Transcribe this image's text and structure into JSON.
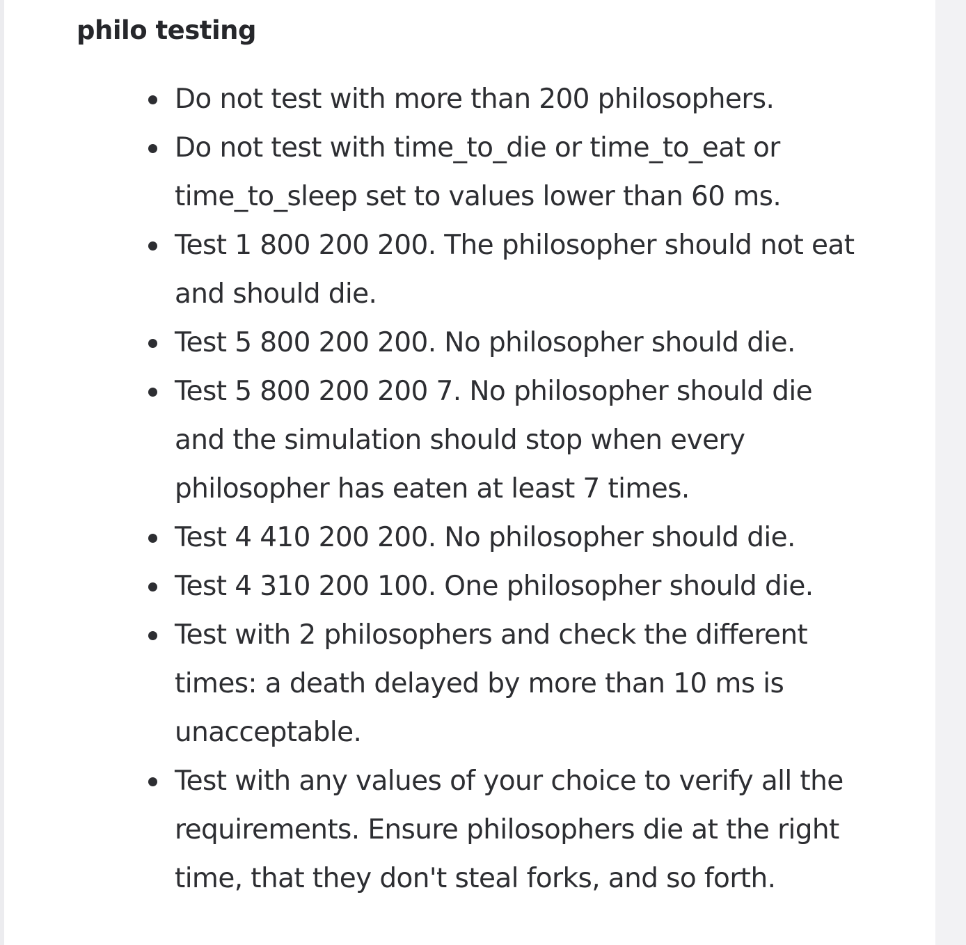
{
  "section": {
    "title": "philo testing"
  },
  "rules": [
    "Do not test with more than 200 philosophers.",
    "Do not test with time_to_die or time_to_eat or time_to_sleep set to values lower than 60 ms.",
    "Test 1 800 200 200. The philosopher should not eat and should die.",
    "Test 5 800 200 200. No philosopher should die.",
    "Test 5 800 200 200 7. No philosopher should die and the simulation should stop when every philosopher has eaten at least 7 times.",
    "Test 4 410 200 200. No philosopher should die.",
    "Test 4 310 200 100. One philosopher should die.",
    "Test with 2 philosophers and check the different times: a death delayed by more than 10 ms is unacceptable.",
    "Test with any values of your choice to verify all the requirements. Ensure philosophers die at the right time, that they don't steal forks, and so forth."
  ]
}
